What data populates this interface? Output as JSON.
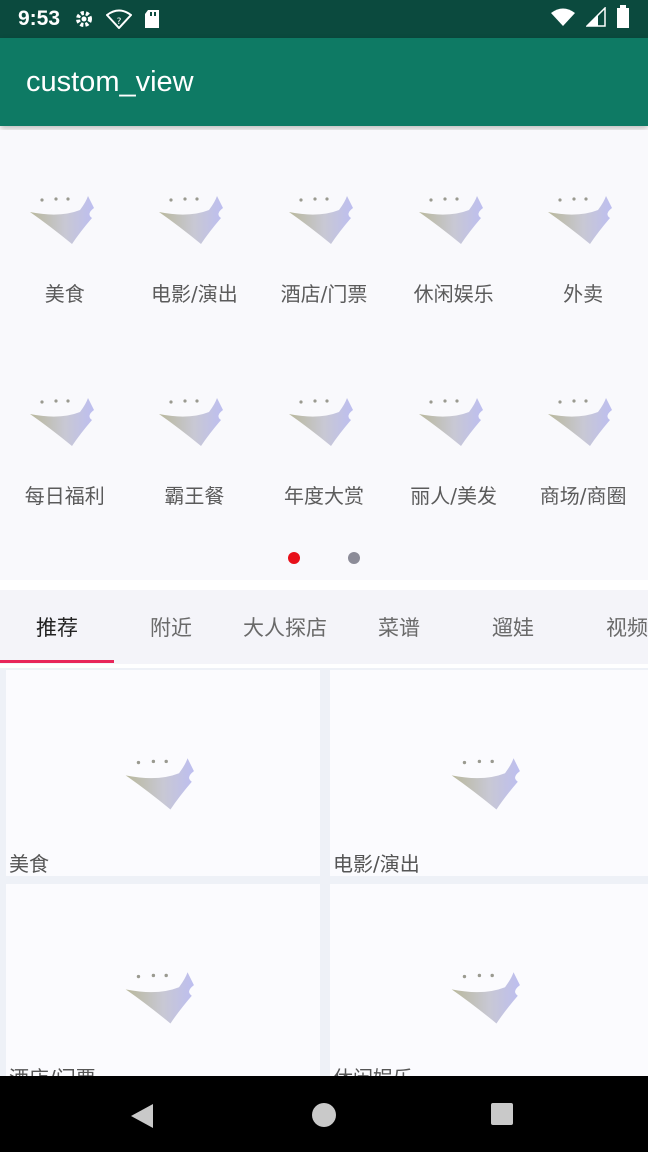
{
  "status_bar": {
    "time": "9:53",
    "left_icons": [
      "gear-icon",
      "wifi-question-icon",
      "sd-card-icon"
    ],
    "right_icons": [
      "wifi-icon",
      "signal-icon",
      "battery-icon"
    ]
  },
  "app_bar": {
    "title": "custom_view"
  },
  "categories": {
    "row1": [
      {
        "label": "美食",
        "icon": "placeholder-image-icon"
      },
      {
        "label": "电影/演出",
        "icon": "placeholder-image-icon"
      },
      {
        "label": "酒店/门票",
        "icon": "placeholder-image-icon"
      },
      {
        "label": "休闲娱乐",
        "icon": "placeholder-image-icon"
      },
      {
        "label": "外卖",
        "icon": "placeholder-image-icon"
      }
    ],
    "row2": [
      {
        "label": "每日福利",
        "icon": "placeholder-image-icon"
      },
      {
        "label": "霸王餐",
        "icon": "placeholder-image-icon"
      },
      {
        "label": "年度大赏",
        "icon": "placeholder-image-icon"
      },
      {
        "label": "丽人/美发",
        "icon": "placeholder-image-icon"
      },
      {
        "label": "商场/商圈",
        "icon": "placeholder-image-icon"
      }
    ],
    "pager": {
      "pages": 2,
      "current": 1,
      "active_color": "#e8101a",
      "inactive_color": "#8c8c98"
    }
  },
  "tabs": {
    "items": [
      "推荐",
      "附近",
      "大人探店",
      "菜谱",
      "遛娃",
      "视频"
    ],
    "selected": 0,
    "indicator_color": "#e8265a"
  },
  "cards": [
    {
      "label": "美食"
    },
    {
      "label": "电影/演出"
    },
    {
      "label": "酒店/门票"
    },
    {
      "label": "休闲娱乐"
    }
  ],
  "nav_bar": {
    "buttons": [
      "back-icon",
      "home-icon",
      "recents-icon"
    ]
  },
  "colors": {
    "status_bar": "#0b4a3e",
    "app_bar": "#0e7a64"
  }
}
